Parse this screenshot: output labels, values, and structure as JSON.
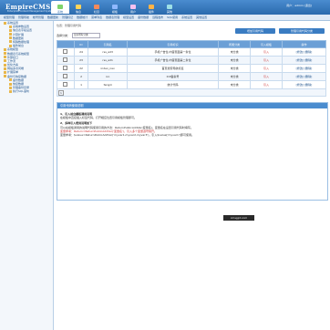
{
  "header": {
    "logo": "EmpireCMS",
    "logo_sub": "Enterprise Content Management System",
    "user_text": "用户：admin  [退出]",
    "nav": [
      {
        "label": "系统",
        "color": "#7fd36b",
        "active": true
      },
      {
        "label": "信息",
        "color": "#ffd45a"
      },
      {
        "label": "栏目",
        "color": "#f58a5b"
      },
      {
        "label": "模板",
        "color": "#8fb8ff"
      },
      {
        "label": "用户",
        "color": "#f5c0f0"
      },
      {
        "label": "插件",
        "color": "#ffb347"
      },
      {
        "label": "其他",
        "color": "#9de0e6"
      }
    ]
  },
  "menubar": [
    "模型管理",
    "管理导航",
    "帐号管理",
    "数据更新",
    "管理标记",
    "数据统计",
    "菜单列表",
    "数据表管理",
    "模型设置",
    "备份数据",
    "远程发布",
    "SQL使用",
    "系统设置",
    "其他设置"
  ],
  "sidebar": [
    {
      "label": "系统设置",
      "level": 1
    },
    {
      "label": "系统参数设置",
      "level": 2
    },
    {
      "label": "信息表字段设置",
      "level": 2
    },
    {
      "label": "计算扩展",
      "level": 2
    },
    {
      "label": "数据更新",
      "level": 2
    },
    {
      "label": "特殊数据处理",
      "level": 2
    },
    {
      "label": "插件前台",
      "level": 2
    },
    {
      "label": "系统模型",
      "level": 1
    },
    {
      "label": "数据表与系统模型",
      "level": 1
    },
    {
      "label": "外部接口",
      "level": 1
    },
    {
      "label": "工作流",
      "level": 1
    },
    {
      "label": "优化方案",
      "level": 1
    },
    {
      "label": "网站多访问端",
      "level": 1
    },
    {
      "label": "扩展菜单",
      "level": 1
    },
    {
      "label": "备份与恢复数据",
      "level": 1
    },
    {
      "label": "备份数据",
      "level": 2
    },
    {
      "label": "恢复数据",
      "level": 2
    },
    {
      "label": "管理备份目录",
      "level": 2
    },
    {
      "label": "执行SQL语句",
      "level": 2
    }
  ],
  "main": {
    "breadcrumb": "位置：管理引用代码",
    "btn_add": "增加引用代码",
    "btn_manage": "管理引用代码分类",
    "filter_label": "选择分类：",
    "filter_value": "显示所有分类",
    "table": {
      "headers": [
        "ID",
        "引用名",
        "引用标识",
        "所属分类",
        "引入模板",
        "操作"
      ],
      "rows": [
        {
          "id": "24",
          "name": "rss_ad3",
          "mark": "手机广告位-内容页面第一条位",
          "cat": "未分类",
          "tpl": "引入",
          "op": "[修改] [删除]"
        },
        {
          "id": "23",
          "name": "rss_ad1",
          "mark": "手机广告位-内容页面第二条位",
          "cat": "未分类",
          "tpl": "引入",
          "op": "[修改] [删除]"
        },
        {
          "id": "22",
          "name": "index_nav",
          "mark": "首页搜索导航标签",
          "cat": "未分类",
          "tpl": "引入",
          "op": "[修改] [删除]"
        },
        {
          "id": "2",
          "name": "ico",
          "mark": "ICP备案号",
          "cat": "未分类",
          "tpl": "引入",
          "op": "[修改] [删除]"
        },
        {
          "id": "1",
          "name": "fengzi",
          "mark": "统计代码",
          "cat": "未分类",
          "tpl": "引入",
          "op": "[修改] [删除]"
        }
      ],
      "page_num": "1"
    }
  },
  "panel": {
    "title": "引用代码使用说明",
    "lines": [
      {
        "text": "1、引入前台模板调用说明",
        "bold": true
      },
      {
        "text": "在模板中直接插入标签代码，打开相应位置引用模板管理即可。"
      },
      {
        "text": "2、多种引入使用说明如下",
        "bold": true
      },
      {
        "text": "可以在模板通用的说明代码使用引用的方法：ReturnPublicAddVar(变量名)，变量名在设置引用代码时填写。"
      },
      {
        "text": "变量参考：Return=ReturnPublicAddVar('变量名')，引入多个变量逗号隔开。",
        "hl": true
      },
      {
        "text": "变量参考：$value=ReturnPublicAddVar('myvar1,myvar2,myvar3')，引入$value['myvar1']即可使用。"
      }
    ]
  },
  "watermark": "cmsgpt.com"
}
